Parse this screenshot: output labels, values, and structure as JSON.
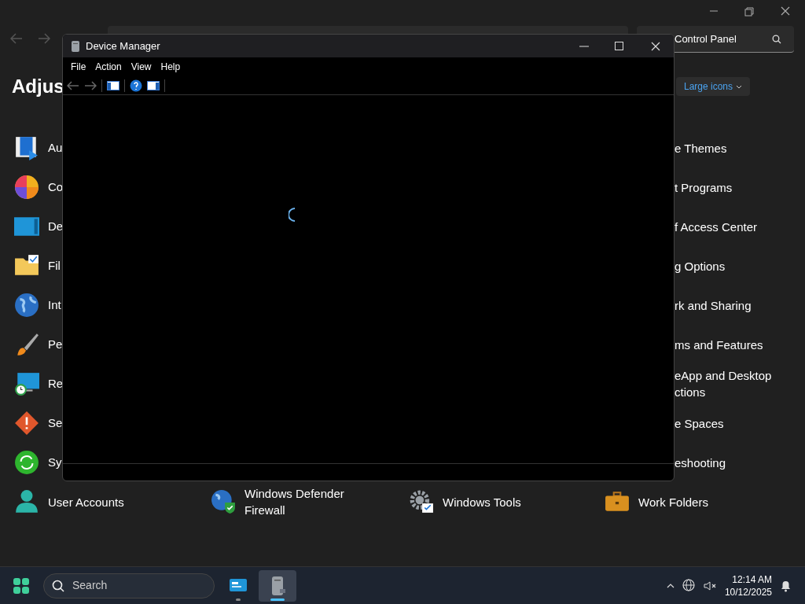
{
  "control_panel": {
    "search": {
      "placeholder": "Control Panel"
    },
    "heading": "Adjus",
    "view_by": {
      "value": "Large icons"
    },
    "left_items": [
      {
        "label": "Au"
      },
      {
        "label": "Co"
      },
      {
        "label": "De"
      },
      {
        "label": "Fil"
      },
      {
        "label": "Int"
      },
      {
        "label": "Pe"
      },
      {
        "label": "Re"
      },
      {
        "label": "Se"
      },
      {
        "label": "Sy"
      }
    ],
    "right_items": [
      {
        "lines": [
          "e Themes"
        ]
      },
      {
        "lines": [
          "t Programs"
        ]
      },
      {
        "lines": [
          "f Access Center"
        ]
      },
      {
        "lines": [
          "g Options"
        ]
      },
      {
        "lines": [
          "rk and Sharing"
        ]
      },
      {
        "lines": [
          "ms and Features"
        ]
      },
      {
        "lines": [
          "eApp and Desktop",
          "ctions"
        ]
      },
      {
        "lines": [
          "e Spaces"
        ]
      },
      {
        "lines": [
          "eshooting"
        ]
      }
    ],
    "bottom_items": [
      {
        "lines": [
          "User Accounts"
        ]
      },
      {
        "lines": [
          "Windows Defender",
          "Firewall"
        ]
      },
      {
        "lines": [
          "Windows Tools"
        ]
      },
      {
        "lines": [
          "Work Folders"
        ]
      }
    ]
  },
  "device_manager": {
    "title": "Device Manager",
    "menu": [
      "File",
      "Action",
      "View",
      "Help"
    ]
  },
  "taskbar": {
    "search": {
      "placeholder": "Search"
    },
    "apps": [
      {
        "selected": false
      },
      {
        "selected": true
      }
    ],
    "clock": {
      "time": "12:14 AM",
      "date": "10/12/2025"
    }
  }
}
